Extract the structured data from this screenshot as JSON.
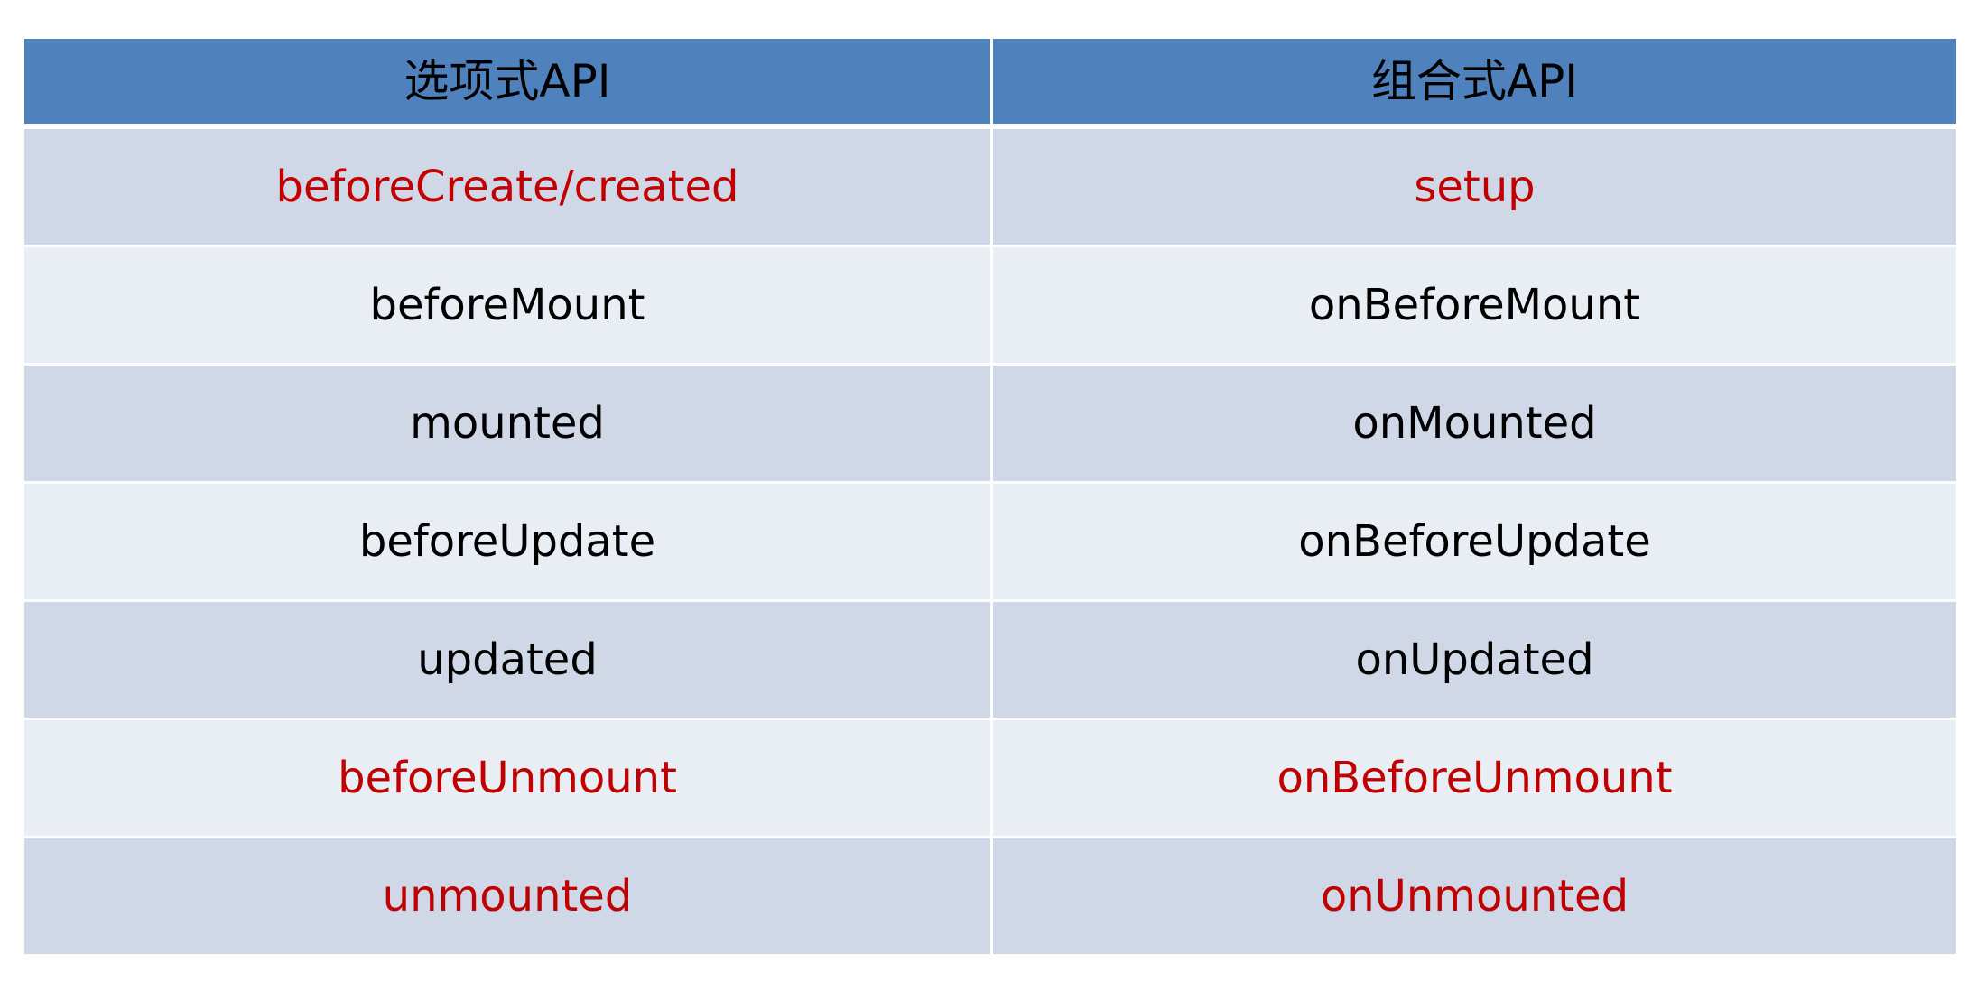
{
  "table": {
    "headers": [
      "选项式API",
      "组合式API"
    ],
    "rows": [
      {
        "options_api": "beforeCreate/created",
        "composition_api": "setup",
        "highlight": true
      },
      {
        "options_api": "beforeMount",
        "composition_api": "onBeforeMount",
        "highlight": false
      },
      {
        "options_api": "mounted",
        "composition_api": "onMounted",
        "highlight": false
      },
      {
        "options_api": "beforeUpdate",
        "composition_api": "onBeforeUpdate",
        "highlight": false
      },
      {
        "options_api": "updated",
        "composition_api": "onUpdated",
        "highlight": false
      },
      {
        "options_api": "beforeUnmount",
        "composition_api": "onBeforeUnmount",
        "highlight": true
      },
      {
        "options_api": "unmounted",
        "composition_api": "onUnmounted",
        "highlight": true
      }
    ]
  },
  "colors": {
    "header_bg": "#4f81bd",
    "row_odd_bg": "#d0d8e8",
    "row_even_bg": "#e9edf4",
    "highlight_text": "#c00000",
    "normal_text": "#000000"
  }
}
